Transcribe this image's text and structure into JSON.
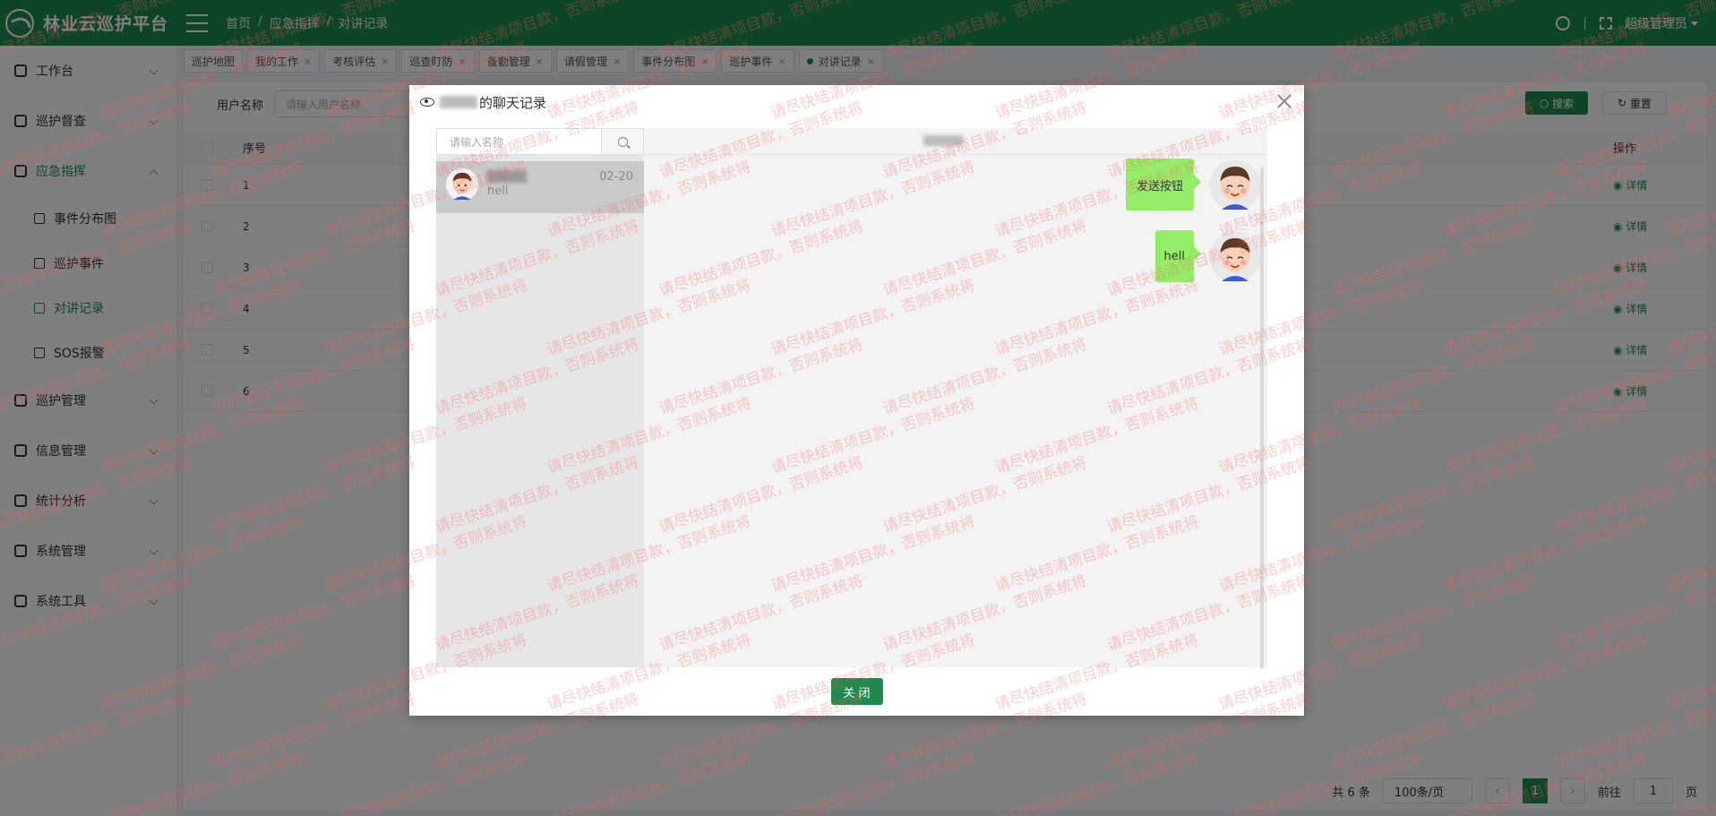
{
  "app": {
    "title": "林业云巡护平台"
  },
  "breadcrumb": [
    "首页",
    "应急指挥",
    "对讲记录"
  ],
  "header": {
    "user": "超级管理员"
  },
  "sidebar": {
    "items": [
      {
        "label": "工作台"
      },
      {
        "label": "巡护督查"
      },
      {
        "label": "应急指挥"
      },
      {
        "label": "巡护管理"
      },
      {
        "label": "信息管理"
      },
      {
        "label": "统计分析"
      },
      {
        "label": "系统管理"
      },
      {
        "label": "系统工具"
      }
    ],
    "subitems": [
      {
        "label": "事件分布图"
      },
      {
        "label": "巡护事件"
      },
      {
        "label": "对讲记录"
      },
      {
        "label": "SOS报警"
      }
    ]
  },
  "tabs": [
    "巡护地图",
    "我的工作",
    "考核评估",
    "巡查盯防",
    "备勤管理",
    "请假管理",
    "事件分布图",
    "巡护事件",
    "对讲记录"
  ],
  "filters": {
    "username_label": "用户名称",
    "username_placeholder": "请输入用户名称",
    "search_label": "搜索",
    "reset_label": "重置"
  },
  "table": {
    "headers": {
      "index": "序号",
      "operation": "操作"
    },
    "rows": [
      {
        "index": "1",
        "op": "详情"
      },
      {
        "index": "2",
        "op": "详情"
      },
      {
        "index": "3",
        "op": "详情"
      },
      {
        "index": "4",
        "op": "详情"
      },
      {
        "index": "5",
        "op": "详情"
      },
      {
        "index": "6",
        "op": "详情"
      }
    ]
  },
  "pagination": {
    "total": "共 6 条",
    "page_size": "100条/页",
    "current": "1",
    "goto_prefix": "前往",
    "goto_value": "1",
    "goto_suffix": "页"
  },
  "modal": {
    "title_suffix": "的聊天记录",
    "search_placeholder": "请输入名称",
    "contact": {
      "time": "02-20",
      "last_message": "hell"
    },
    "messages": [
      "发送按钮",
      "hell"
    ],
    "close_label": "关 闭"
  },
  "watermark": {
    "text": "请尽快结清项目款，否则系统将"
  },
  "colors": {
    "brand": "#1f8a4f",
    "bubble": "#95ec69"
  }
}
